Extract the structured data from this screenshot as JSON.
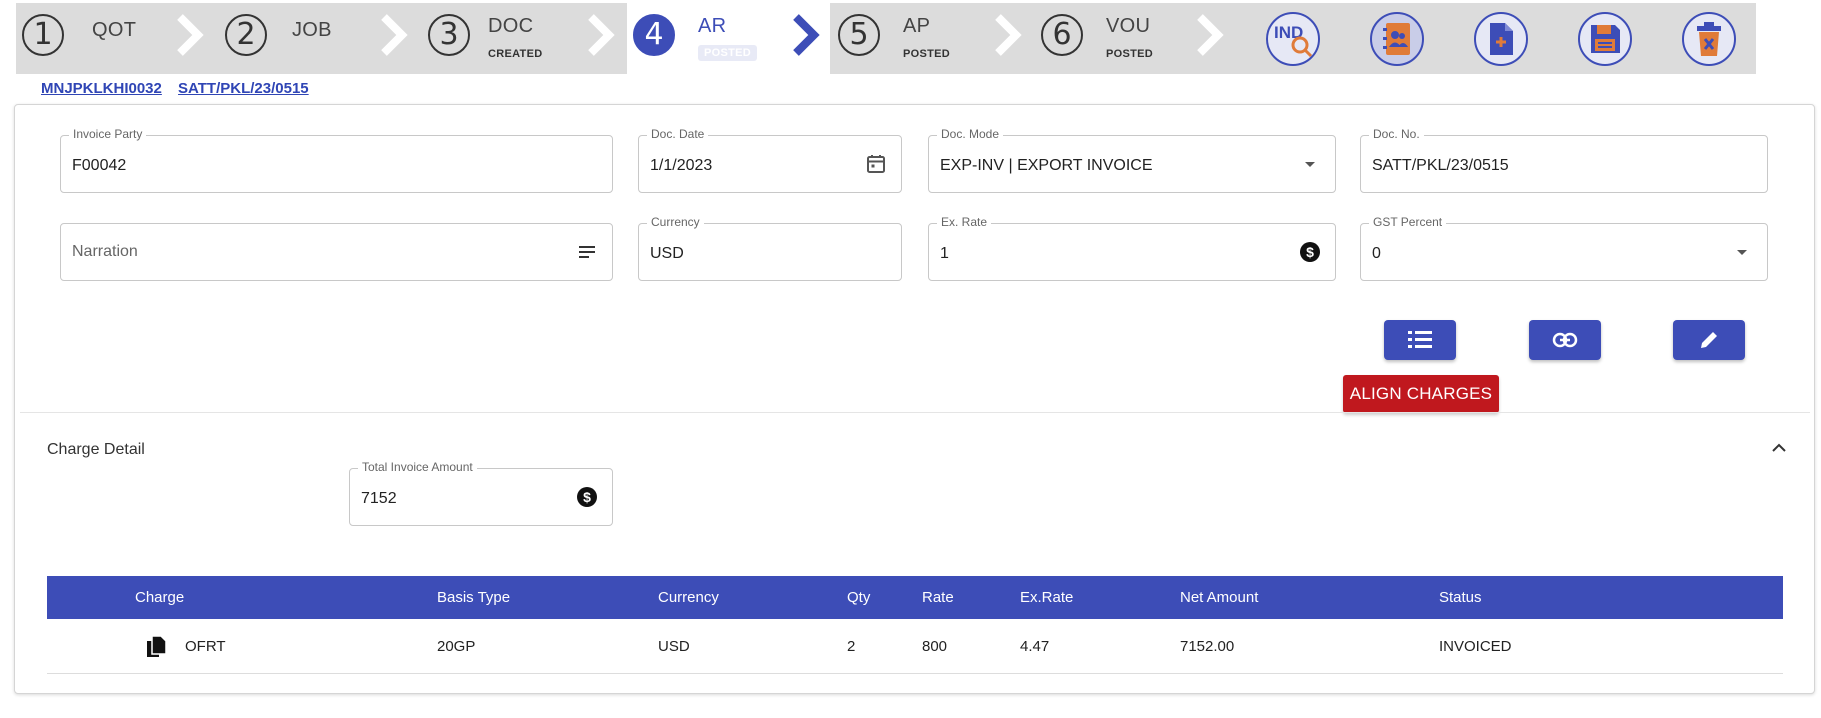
{
  "stepper": {
    "steps": [
      {
        "num": "1",
        "label": "QOT",
        "sub": ""
      },
      {
        "num": "2",
        "label": "JOB",
        "sub": ""
      },
      {
        "num": "3",
        "label": "DOC",
        "sub": "CREATED"
      },
      {
        "num": "4",
        "label": "AR",
        "sub": "POSTED"
      },
      {
        "num": "5",
        "label": "AP",
        "sub": "POSTED"
      },
      {
        "num": "6",
        "label": "VOU",
        "sub": "POSTED"
      }
    ],
    "active_step": 4,
    "actions": [
      {
        "icon": "ind-search-icon",
        "label": "IND"
      },
      {
        "icon": "contact-book-icon"
      },
      {
        "icon": "new-document-icon"
      },
      {
        "icon": "save-disk-icon"
      },
      {
        "icon": "delete-bin-icon"
      }
    ]
  },
  "links": {
    "job_ref": "MNJPKLKHI0032",
    "doc_ref": "SATT/PKL/23/0515"
  },
  "form": {
    "invoice_party": {
      "label": "Invoice Party",
      "value": "F00042"
    },
    "doc_date": {
      "label": "Doc. Date",
      "value": "1/1/2023"
    },
    "doc_mode": {
      "label": "Doc. Mode",
      "value": "EXP-INV | EXPORT INVOICE"
    },
    "doc_no": {
      "label": "Doc. No.",
      "value": "SATT/PKL/23/0515"
    },
    "narration": {
      "placeholder": "Narration"
    },
    "currency": {
      "label": "Currency",
      "value": "USD"
    },
    "ex_rate": {
      "label": "Ex. Rate",
      "value": "1"
    },
    "gst_percent": {
      "label": "GST Percent",
      "value": "0"
    }
  },
  "buttons": {
    "align_charges": "ALIGN CHARGES"
  },
  "charge_detail": {
    "title": "Charge Detail",
    "total_label": "Total Invoice Amount",
    "total_value": "7152"
  },
  "table": {
    "headers": [
      "Charge",
      "Basis Type",
      "Currency",
      "Qty",
      "Rate",
      "Ex.Rate",
      "Net Amount",
      "Status"
    ],
    "rows": [
      {
        "charge": "OFRT",
        "basis": "20GP",
        "currency": "USD",
        "qty": "2",
        "rate": "800",
        "ex_rate": "4.47",
        "net": "7152.00",
        "status": "INVOICED"
      }
    ]
  },
  "colors": {
    "primary": "#3d4db7",
    "danger": "#c0181e",
    "stepbar": "#dcdcdc",
    "icon_orange": "#e07b39"
  }
}
